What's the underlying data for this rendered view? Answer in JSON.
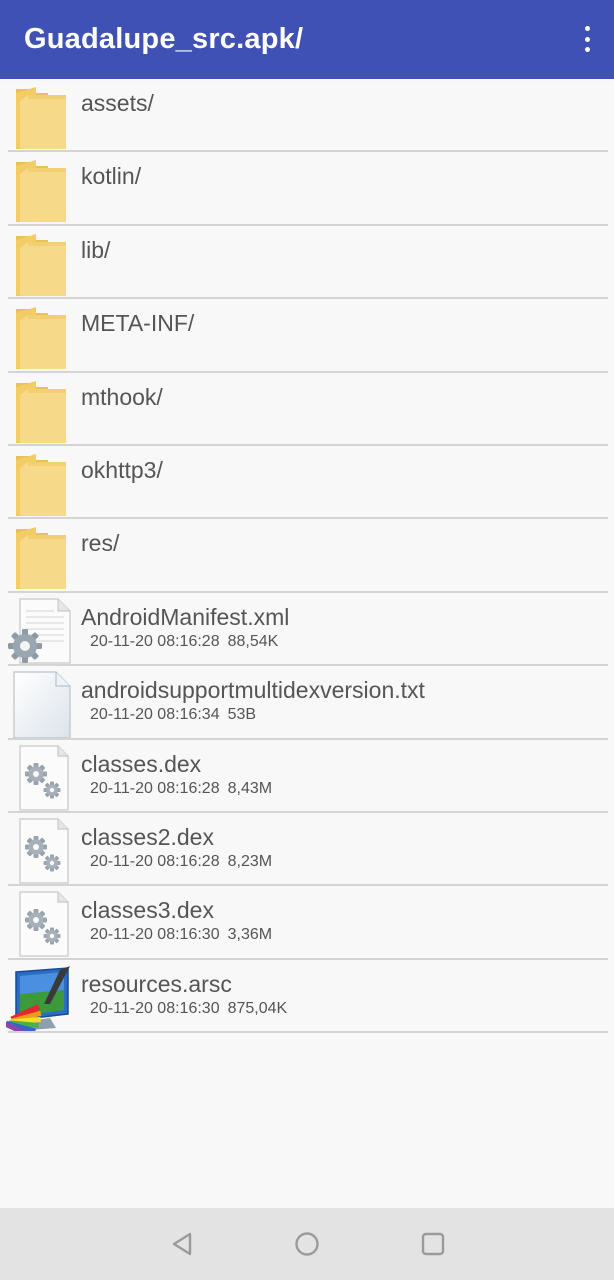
{
  "appbar": {
    "title": "Guadalupe_src.apk/",
    "overflow_icon": "more-vert-icon"
  },
  "files": [
    {
      "name": "assets/",
      "type": "folder",
      "icon": "folder-icon"
    },
    {
      "name": "kotlin/",
      "type": "folder",
      "icon": "folder-icon"
    },
    {
      "name": "lib/",
      "type": "folder",
      "icon": "folder-icon"
    },
    {
      "name": "META-INF/",
      "type": "folder",
      "icon": "folder-icon"
    },
    {
      "name": "mthook/",
      "type": "folder",
      "icon": "folder-icon"
    },
    {
      "name": "okhttp3/",
      "type": "folder",
      "icon": "folder-icon"
    },
    {
      "name": "res/",
      "type": "folder",
      "icon": "folder-icon"
    },
    {
      "name": "AndroidManifest.xml",
      "type": "xml",
      "icon": "xml-file-icon",
      "date": "20-11-20 08:16:28",
      "size": "88,54K"
    },
    {
      "name": "androidsupportmultidexversion.txt",
      "type": "txt",
      "icon": "text-file-icon",
      "date": "20-11-20 08:16:34",
      "size": "53B"
    },
    {
      "name": "classes.dex",
      "type": "dex",
      "icon": "dex-file-icon",
      "date": "20-11-20 08:16:28",
      "size": "8,43M"
    },
    {
      "name": "classes2.dex",
      "type": "dex",
      "icon": "dex-file-icon",
      "date": "20-11-20 08:16:28",
      "size": "8,23M"
    },
    {
      "name": "classes3.dex",
      "type": "dex",
      "icon": "dex-file-icon",
      "date": "20-11-20 08:16:30",
      "size": "3,36M"
    },
    {
      "name": "resources.arsc",
      "type": "arsc",
      "icon": "arsc-file-icon",
      "date": "20-11-20 08:16:30",
      "size": "875,04K"
    }
  ],
  "navbar": {
    "back_icon": "back-icon",
    "home_icon": "home-icon",
    "recents_icon": "recents-icon"
  },
  "colors": {
    "appbar": "#3f51b5",
    "text": "#555555",
    "folder": "#f4d47a",
    "divider": "#d4d4d4"
  }
}
